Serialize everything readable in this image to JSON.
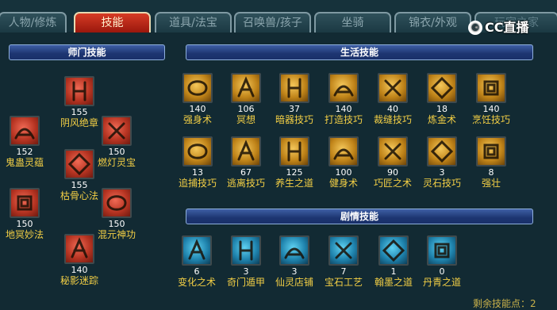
{
  "tabs": [
    {
      "label": "人物/修炼"
    },
    {
      "label": "技能"
    },
    {
      "label": "道具/法宝"
    },
    {
      "label": "召唤兽/孩子"
    },
    {
      "label": "坐骑"
    },
    {
      "label": "锦衣/外观"
    },
    {
      "label": "玩家之家"
    }
  ],
  "active_tab": "技能",
  "logo": {
    "text": "CC直播"
  },
  "sections": {
    "shimen": {
      "title": "师门技能",
      "skills": [
        {
          "level": "155",
          "name": "阴风绝章",
          "icon": "cloud-swirl-icon"
        },
        {
          "level": "152",
          "name": "鬼蛊灵蕴",
          "icon": "beast-claw-icon"
        },
        {
          "level": "150",
          "name": "燃灯灵宝",
          "icon": "lantern-wheel-icon"
        },
        {
          "level": "155",
          "name": "枯骨心法",
          "icon": "figure-icon"
        },
        {
          "level": "150",
          "name": "地冥妙法",
          "icon": "mushroom-icon"
        },
        {
          "level": "150",
          "name": "混元神功",
          "icon": "spiral-icon"
        },
        {
          "level": "140",
          "name": "秘影迷踪",
          "icon": "ghost-trail-icon"
        }
      ]
    },
    "life": {
      "title": "生活技能",
      "skills": [
        {
          "level": "140",
          "name": "强身术",
          "icon": "muscle-icon"
        },
        {
          "level": "106",
          "name": "冥想",
          "icon": "meditation-icon"
        },
        {
          "level": "37",
          "name": "暗器技巧",
          "icon": "dart-icon"
        },
        {
          "level": "140",
          "name": "打造技巧",
          "icon": "hammer-icon"
        },
        {
          "level": "40",
          "name": "裁缝技巧",
          "icon": "scissors-icon"
        },
        {
          "level": "18",
          "name": "炼金术",
          "icon": "alchemy-icon"
        },
        {
          "level": "140",
          "name": "烹饪技巧",
          "icon": "cooking-icon"
        },
        {
          "level": "13",
          "name": "追捕技巧",
          "icon": "chain-icon"
        },
        {
          "level": "67",
          "name": "逃离技巧",
          "icon": "escape-icon"
        },
        {
          "level": "125",
          "name": "养生之道",
          "icon": "health-icon"
        },
        {
          "level": "100",
          "name": "健身术",
          "icon": "fitness-icon"
        },
        {
          "level": "90",
          "name": "巧匠之术",
          "icon": "craftsman-icon"
        },
        {
          "level": "3",
          "name": "灵石技巧",
          "icon": "gem-icon"
        },
        {
          "level": "8",
          "name": "强壮",
          "icon": "strong-icon"
        }
      ]
    },
    "story": {
      "title": "剧情技能",
      "skills": [
        {
          "level": "6",
          "name": "变化之术",
          "icon": "transform-icon"
        },
        {
          "level": "3",
          "name": "奇门遁甲",
          "icon": "maze-icon"
        },
        {
          "level": "3",
          "name": "仙灵店铺",
          "icon": "shop-icon"
        },
        {
          "level": "7",
          "name": "宝石工艺",
          "icon": "gemcraft-icon"
        },
        {
          "level": "1",
          "name": "翰墨之道",
          "icon": "ink-icon"
        },
        {
          "level": "0",
          "name": "丹青之道",
          "icon": "painting-icon"
        }
      ]
    }
  },
  "footer": {
    "text": "剩余技能点：2"
  }
}
